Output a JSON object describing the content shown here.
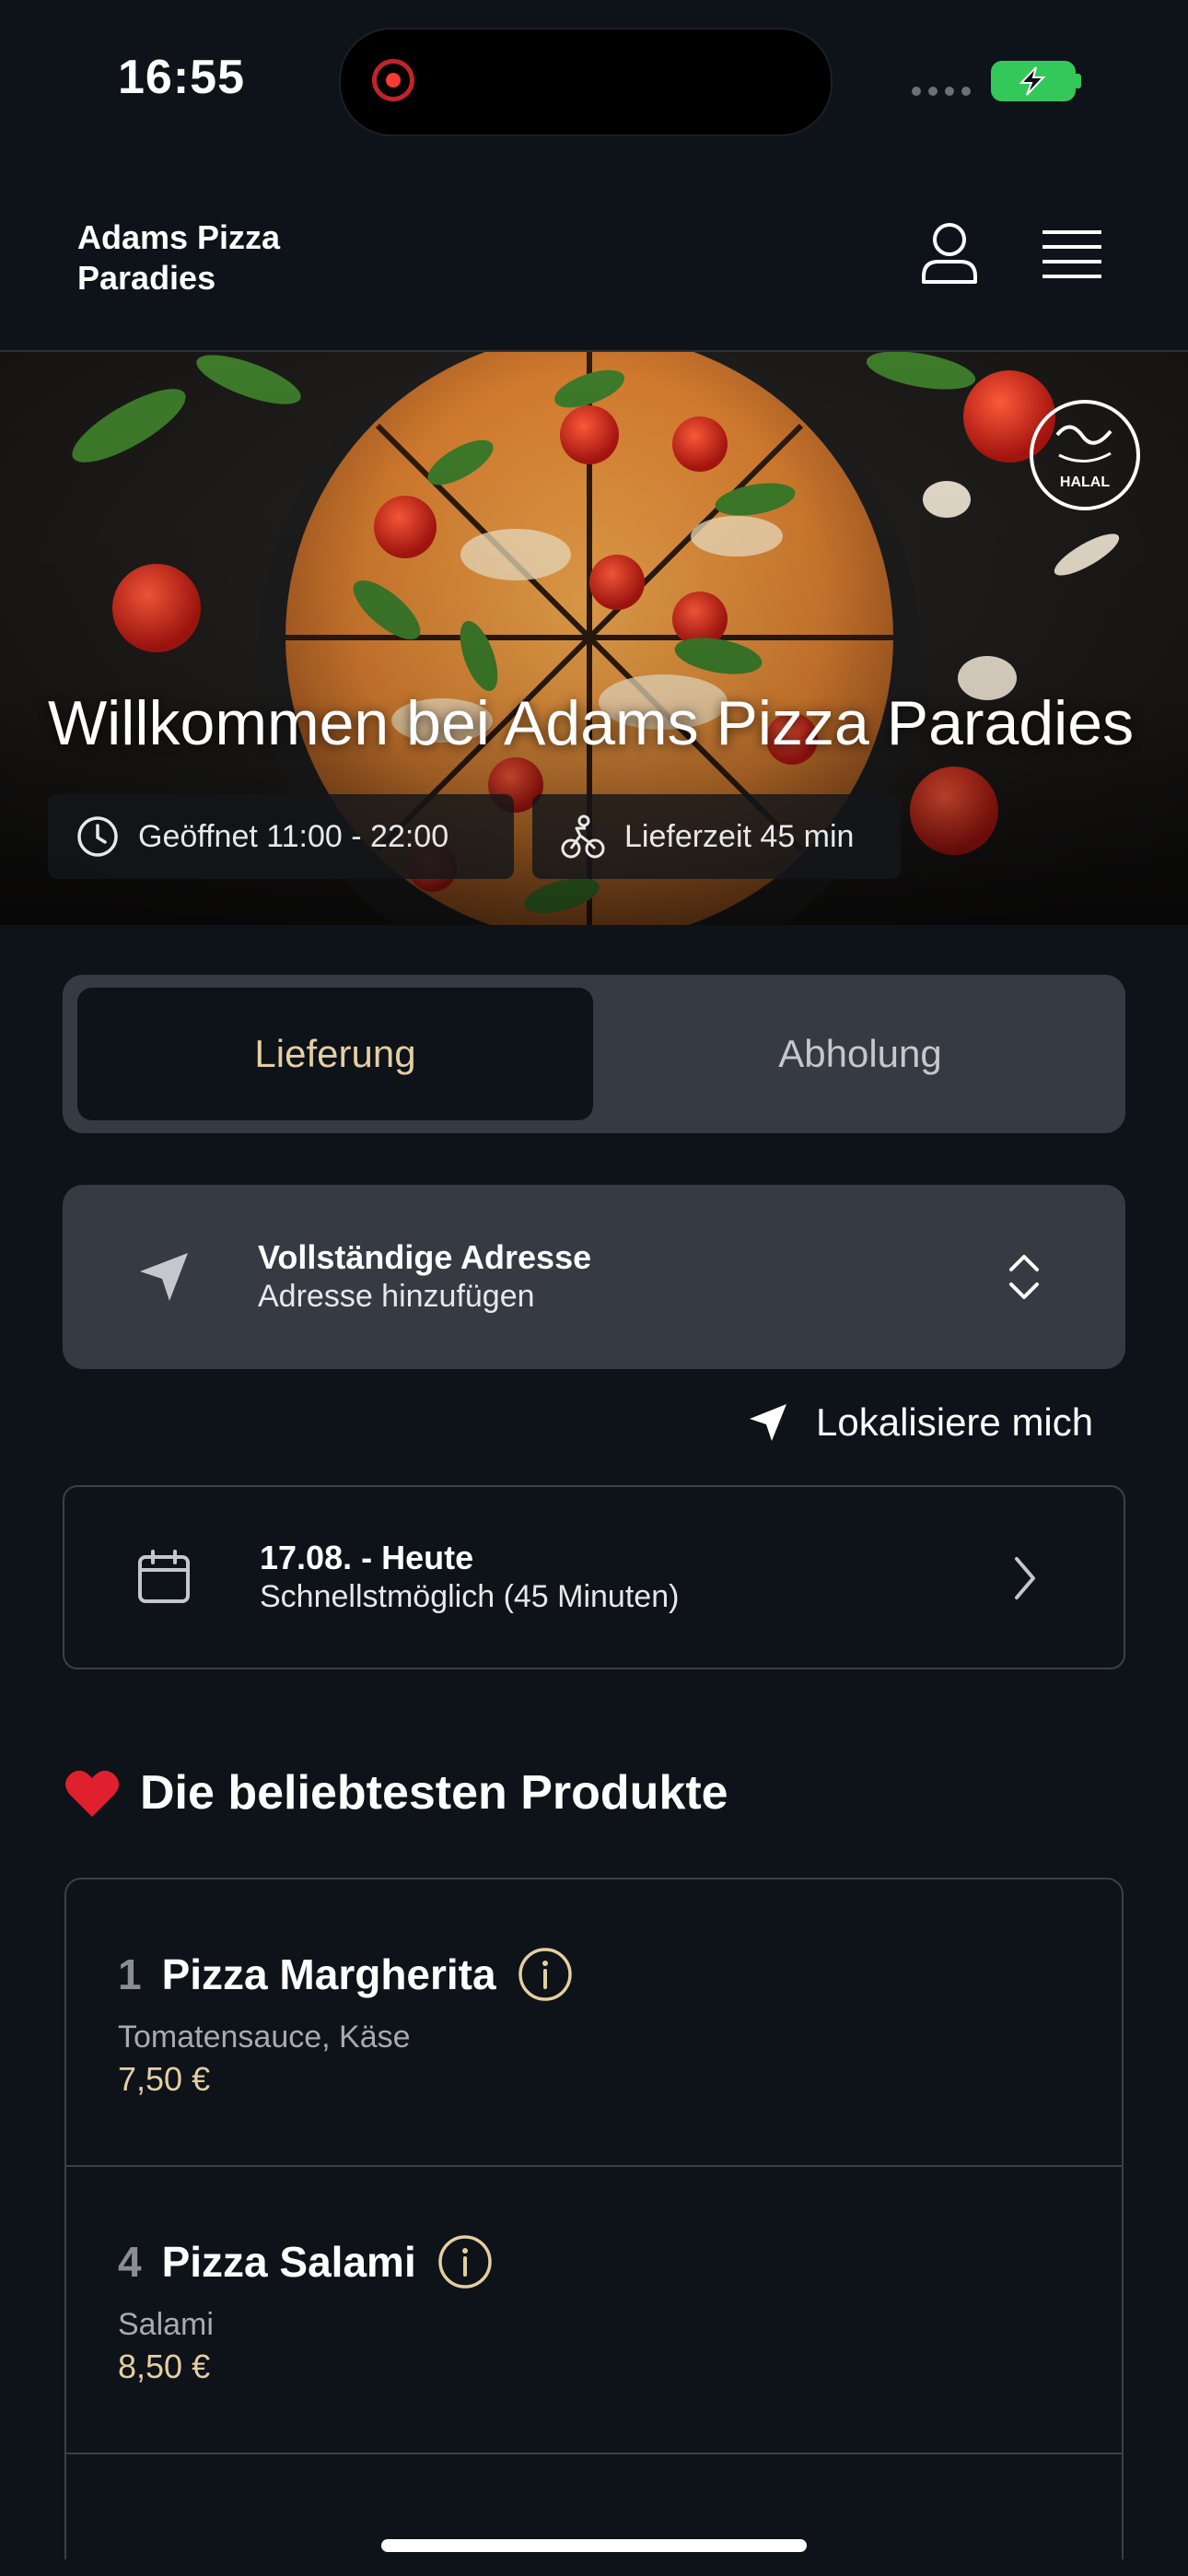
{
  "status_bar": {
    "time": "16:55"
  },
  "header": {
    "brand": "Adams Pizza Paradies"
  },
  "hero": {
    "title": "Willkommen bei Adams Pizza Paradies",
    "badge": "HALAL",
    "opening_hours": "Geöffnet 11:00 - 22:00",
    "delivery_time": "Lieferzeit 45 min"
  },
  "order_mode": {
    "options": [
      "Lieferung",
      "Abholung"
    ],
    "selected": "Lieferung"
  },
  "address": {
    "title": "Vollständige Adresse",
    "subtitle": "Adresse hinzufügen",
    "locate_label": "Lokalisiere mich"
  },
  "delivery_date": {
    "title": "17.08. - Heute",
    "subtitle": "Schnellstmöglich (45 Minuten)"
  },
  "popular": {
    "heading": "Die beliebtesten Produkte",
    "items": [
      {
        "number": "1",
        "name": "Pizza Margherita",
        "description": "Tomatensauce, Käse",
        "price": "7,50 €"
      },
      {
        "number": "4",
        "name": "Pizza Salami",
        "description": "Salami",
        "price": "8,50 €"
      }
    ]
  },
  "colors": {
    "background": "#0e1219",
    "accent_gold": "#e3cfa0",
    "card": "#363a43",
    "battery": "#34c759"
  }
}
